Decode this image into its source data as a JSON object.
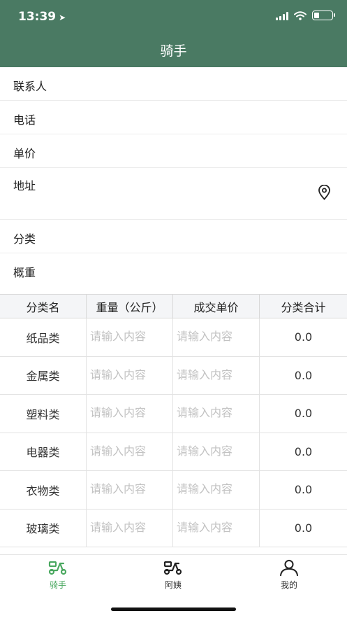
{
  "status_bar": {
    "time": "13:39"
  },
  "nav": {
    "title": "骑手"
  },
  "form": {
    "contact_label": "联系人",
    "phone_label": "电话",
    "unit_price_label": "单价",
    "address_label": "地址",
    "category_label": "分类",
    "approx_weight_label": "概重"
  },
  "table": {
    "headers": [
      "分类名",
      "重量（公斤）",
      "成交单价",
      "分类合计"
    ],
    "placeholder": "请输入内容",
    "rows": [
      {
        "name": "纸品类",
        "total": "0.0"
      },
      {
        "name": "金属类",
        "total": "0.0"
      },
      {
        "name": "塑料类",
        "total": "0.0"
      },
      {
        "name": "电器类",
        "total": "0.0"
      },
      {
        "name": "衣物类",
        "total": "0.0"
      },
      {
        "name": "玻璃类",
        "total": "0.0"
      }
    ]
  },
  "tabs": [
    {
      "label": "骑手",
      "icon": "scooter-icon",
      "active": true
    },
    {
      "label": "阿姨",
      "icon": "scooter-icon",
      "active": false
    },
    {
      "label": "我的",
      "icon": "person-icon",
      "active": false
    }
  ],
  "colors": {
    "header_bg": "#4a7a63",
    "active_tab": "#4aa860",
    "placeholder": "#c2c2c2"
  }
}
